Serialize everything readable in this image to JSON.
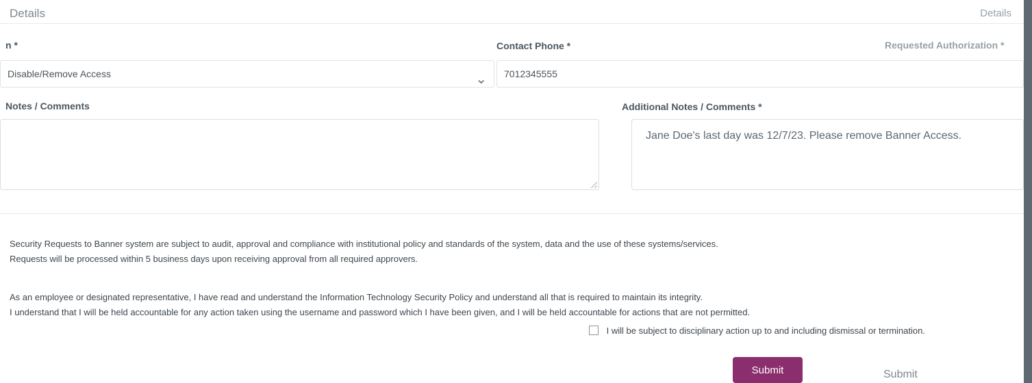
{
  "section": {
    "title": "Details",
    "collapse_label": "Details"
  },
  "fields": {
    "request_type_label": "n *",
    "request_type_value": "Disable/Remove Access",
    "contact_phone_label": "Contact Phone *",
    "contact_phone_value": "7012345555",
    "requested_authorization_label": "Requested Authorization *",
    "notes_label": "Notes / Comments",
    "additional_notes_label": "Additional Notes / Comments *",
    "additional_notes_value": "Jane Doe's last day was 12/7/23. Please remove Banner Access."
  },
  "agreement": {
    "p1_line1": "Security Requests to Banner system are subject to audit, approval and compliance with institutional policy and standards of the system, data and the use of these systems/services.",
    "p1_line2": "Requests will be processed within 5 business days upon receiving approval from all required approvers.",
    "p2_line1": "As an employee or designated representative, I have read and understand the Information Technology Security Policy and understand all that is required to maintain its integrity.",
    "p2_line2": "I understand that I will be held accountable for any action taken using the username and password which I have been given, and I will be held accountable for actions that are not permitted.",
    "agree_text": "I will be subject to disciplinary action up to and including dismissal or termination."
  },
  "buttons": {
    "submit_label": "Submit",
    "submit_ghost_label": "Submit"
  }
}
